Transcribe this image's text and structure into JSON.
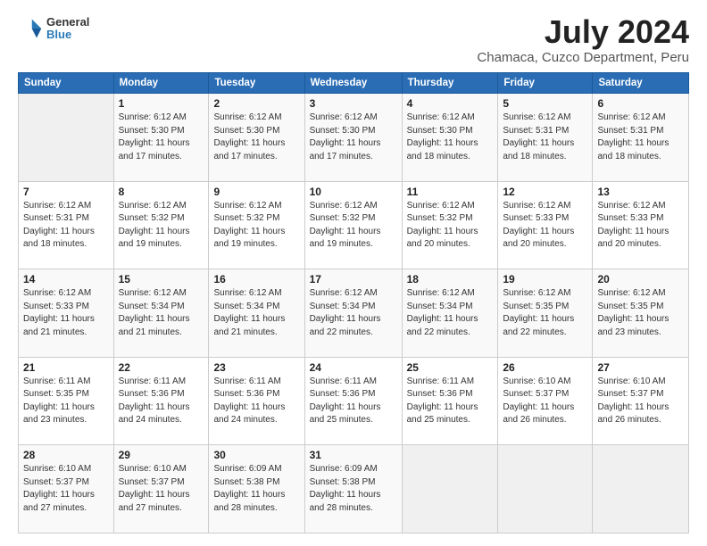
{
  "header": {
    "logo": {
      "general": "General",
      "blue": "Blue"
    },
    "title": "July 2024",
    "location": "Chamaca, Cuzco Department, Peru"
  },
  "calendar": {
    "headers": [
      "Sunday",
      "Monday",
      "Tuesday",
      "Wednesday",
      "Thursday",
      "Friday",
      "Saturday"
    ],
    "weeks": [
      [
        {
          "day": "",
          "info": ""
        },
        {
          "day": "1",
          "info": "Sunrise: 6:12 AM\nSunset: 5:30 PM\nDaylight: 11 hours\nand 17 minutes."
        },
        {
          "day": "2",
          "info": "Sunrise: 6:12 AM\nSunset: 5:30 PM\nDaylight: 11 hours\nand 17 minutes."
        },
        {
          "day": "3",
          "info": "Sunrise: 6:12 AM\nSunset: 5:30 PM\nDaylight: 11 hours\nand 17 minutes."
        },
        {
          "day": "4",
          "info": "Sunrise: 6:12 AM\nSunset: 5:30 PM\nDaylight: 11 hours\nand 18 minutes."
        },
        {
          "day": "5",
          "info": "Sunrise: 6:12 AM\nSunset: 5:31 PM\nDaylight: 11 hours\nand 18 minutes."
        },
        {
          "day": "6",
          "info": "Sunrise: 6:12 AM\nSunset: 5:31 PM\nDaylight: 11 hours\nand 18 minutes."
        }
      ],
      [
        {
          "day": "7",
          "info": "Sunrise: 6:12 AM\nSunset: 5:31 PM\nDaylight: 11 hours\nand 18 minutes."
        },
        {
          "day": "8",
          "info": "Sunrise: 6:12 AM\nSunset: 5:32 PM\nDaylight: 11 hours\nand 19 minutes."
        },
        {
          "day": "9",
          "info": "Sunrise: 6:12 AM\nSunset: 5:32 PM\nDaylight: 11 hours\nand 19 minutes."
        },
        {
          "day": "10",
          "info": "Sunrise: 6:12 AM\nSunset: 5:32 PM\nDaylight: 11 hours\nand 19 minutes."
        },
        {
          "day": "11",
          "info": "Sunrise: 6:12 AM\nSunset: 5:32 PM\nDaylight: 11 hours\nand 20 minutes."
        },
        {
          "day": "12",
          "info": "Sunrise: 6:12 AM\nSunset: 5:33 PM\nDaylight: 11 hours\nand 20 minutes."
        },
        {
          "day": "13",
          "info": "Sunrise: 6:12 AM\nSunset: 5:33 PM\nDaylight: 11 hours\nand 20 minutes."
        }
      ],
      [
        {
          "day": "14",
          "info": "Sunrise: 6:12 AM\nSunset: 5:33 PM\nDaylight: 11 hours\nand 21 minutes."
        },
        {
          "day": "15",
          "info": "Sunrise: 6:12 AM\nSunset: 5:34 PM\nDaylight: 11 hours\nand 21 minutes."
        },
        {
          "day": "16",
          "info": "Sunrise: 6:12 AM\nSunset: 5:34 PM\nDaylight: 11 hours\nand 21 minutes."
        },
        {
          "day": "17",
          "info": "Sunrise: 6:12 AM\nSunset: 5:34 PM\nDaylight: 11 hours\nand 22 minutes."
        },
        {
          "day": "18",
          "info": "Sunrise: 6:12 AM\nSunset: 5:34 PM\nDaylight: 11 hours\nand 22 minutes."
        },
        {
          "day": "19",
          "info": "Sunrise: 6:12 AM\nSunset: 5:35 PM\nDaylight: 11 hours\nand 22 minutes."
        },
        {
          "day": "20",
          "info": "Sunrise: 6:12 AM\nSunset: 5:35 PM\nDaylight: 11 hours\nand 23 minutes."
        }
      ],
      [
        {
          "day": "21",
          "info": "Sunrise: 6:11 AM\nSunset: 5:35 PM\nDaylight: 11 hours\nand 23 minutes."
        },
        {
          "day": "22",
          "info": "Sunrise: 6:11 AM\nSunset: 5:36 PM\nDaylight: 11 hours\nand 24 minutes."
        },
        {
          "day": "23",
          "info": "Sunrise: 6:11 AM\nSunset: 5:36 PM\nDaylight: 11 hours\nand 24 minutes."
        },
        {
          "day": "24",
          "info": "Sunrise: 6:11 AM\nSunset: 5:36 PM\nDaylight: 11 hours\nand 25 minutes."
        },
        {
          "day": "25",
          "info": "Sunrise: 6:11 AM\nSunset: 5:36 PM\nDaylight: 11 hours\nand 25 minutes."
        },
        {
          "day": "26",
          "info": "Sunrise: 6:10 AM\nSunset: 5:37 PM\nDaylight: 11 hours\nand 26 minutes."
        },
        {
          "day": "27",
          "info": "Sunrise: 6:10 AM\nSunset: 5:37 PM\nDaylight: 11 hours\nand 26 minutes."
        }
      ],
      [
        {
          "day": "28",
          "info": "Sunrise: 6:10 AM\nSunset: 5:37 PM\nDaylight: 11 hours\nand 27 minutes."
        },
        {
          "day": "29",
          "info": "Sunrise: 6:10 AM\nSunset: 5:37 PM\nDaylight: 11 hours\nand 27 minutes."
        },
        {
          "day": "30",
          "info": "Sunrise: 6:09 AM\nSunset: 5:38 PM\nDaylight: 11 hours\nand 28 minutes."
        },
        {
          "day": "31",
          "info": "Sunrise: 6:09 AM\nSunset: 5:38 PM\nDaylight: 11 hours\nand 28 minutes."
        },
        {
          "day": "",
          "info": ""
        },
        {
          "day": "",
          "info": ""
        },
        {
          "day": "",
          "info": ""
        }
      ]
    ]
  }
}
